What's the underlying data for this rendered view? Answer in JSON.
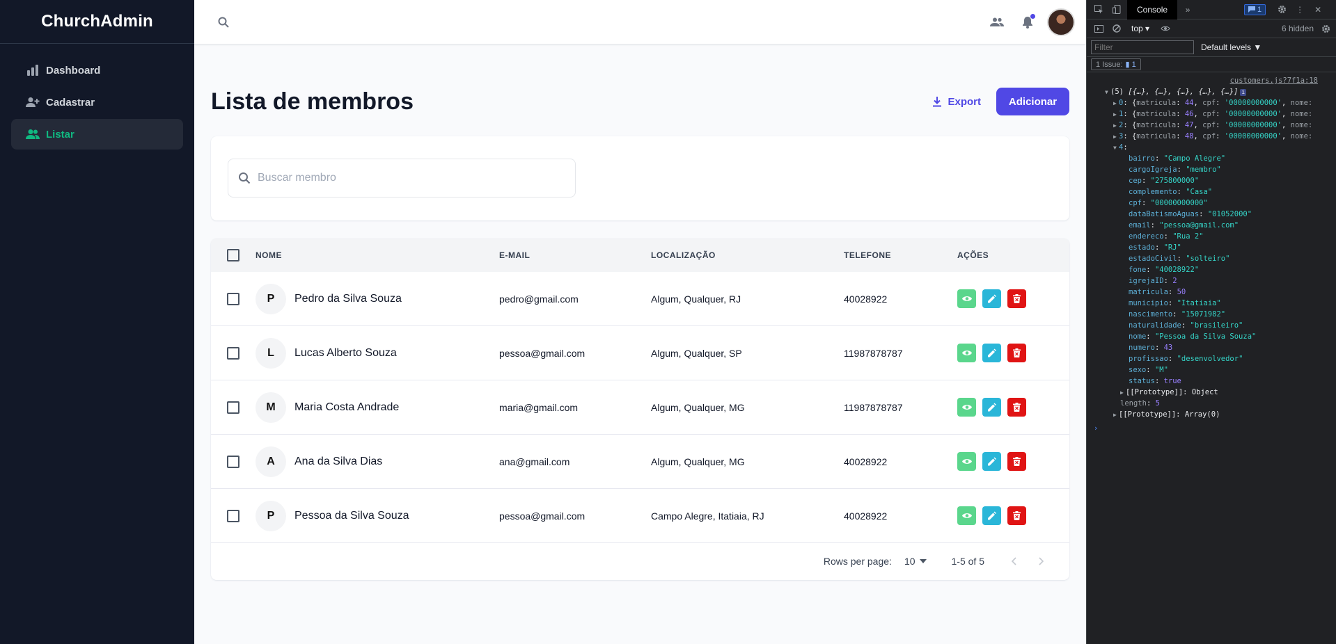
{
  "sidebar": {
    "brand": "ChurchAdmin",
    "items": [
      {
        "label": "Dashboard",
        "active": false,
        "icon": "chart-bar-icon"
      },
      {
        "label": "Cadastrar",
        "active": false,
        "icon": "user-add-icon"
      },
      {
        "label": "Listar",
        "active": true,
        "icon": "users-icon"
      }
    ]
  },
  "topbar": {
    "icons": [
      "search-icon",
      "contacts-icon",
      "bell-icon",
      "user-avatar"
    ]
  },
  "page": {
    "title": "Lista de membros",
    "export_label": "Export",
    "add_label": "Adicionar"
  },
  "search": {
    "placeholder": "Buscar membro"
  },
  "table": {
    "columns": [
      "NOME",
      "E-MAIL",
      "LOCALIZAÇÃO",
      "TELEFONE",
      "AÇÕES"
    ],
    "rows": [
      {
        "initial": "P",
        "name": "Pedro da Silva Souza",
        "email": "pedro@gmail.com",
        "location": "Algum, Qualquer, RJ",
        "phone": "40028922"
      },
      {
        "initial": "L",
        "name": "Lucas Alberto Souza",
        "email": "pessoa@gmail.com",
        "location": "Algum, Qualquer, SP",
        "phone": "11987878787"
      },
      {
        "initial": "M",
        "name": "Maria Costa Andrade",
        "email": "maria@gmail.com",
        "location": "Algum, Qualquer, MG",
        "phone": "11987878787"
      },
      {
        "initial": "A",
        "name": "Ana da Silva Dias",
        "email": "ana@gmail.com",
        "location": "Algum, Qualquer, MG",
        "phone": "40028922"
      },
      {
        "initial": "P",
        "name": "Pessoa da Silva Souza",
        "email": "pessoa@gmail.com",
        "location": "Campo Alegre, Itatiaia, RJ",
        "phone": "40028922"
      }
    ]
  },
  "pagination": {
    "rows_per_page_label": "Rows per page:",
    "rows_per_page_value": "10",
    "range": "1-5 of 5"
  },
  "colors": {
    "primary": "#5048e5",
    "sidebar_bg": "#121828",
    "active_green": "#10b981",
    "view_btn": "#5ad68c",
    "edit_btn": "#2ab6d8",
    "delete_btn": "#e01414"
  },
  "devtools": {
    "tab": "Console",
    "issue_badge": "1",
    "context": "top",
    "hidden": "6 hidden",
    "filter_placeholder": "Filter",
    "levels": "Default levels ▼",
    "issues_label": "1 Issue:",
    "issues_count": "1",
    "source_link": "customers.js?7f1a:18",
    "summary_count": "(5)",
    "summary_items": "[{…}, {…}, {…}, {…}, {…}]",
    "collapsed": [
      {
        "index": "0",
        "matricula": "44",
        "cpf": "'00000000000'"
      },
      {
        "index": "1",
        "matricula": "46",
        "cpf": "'00000000000'"
      },
      {
        "index": "2",
        "matricula": "47",
        "cpf": "'00000000000'"
      },
      {
        "index": "3",
        "matricula": "48",
        "cpf": "'00000000000'"
      }
    ],
    "expanded_index": "4",
    "properties": [
      {
        "key": "bairro",
        "value": "\"Campo Alegre\"",
        "type": "s"
      },
      {
        "key": "cargoIgreja",
        "value": "\"membro\"",
        "type": "s"
      },
      {
        "key": "cep",
        "value": "\"275800000\"",
        "type": "s"
      },
      {
        "key": "complemento",
        "value": "\"Casa\"",
        "type": "s"
      },
      {
        "key": "cpf",
        "value": "\"00000000000\"",
        "type": "s"
      },
      {
        "key": "dataBatismoAguas",
        "value": "\"01052000\"",
        "type": "s"
      },
      {
        "key": "email",
        "value": "\"pessoa@gmail.com\"",
        "type": "s"
      },
      {
        "key": "endereco",
        "value": "\"Rua 2\"",
        "type": "s"
      },
      {
        "key": "estado",
        "value": "\"RJ\"",
        "type": "s"
      },
      {
        "key": "estadoCivil",
        "value": "\"solteiro\"",
        "type": "s"
      },
      {
        "key": "fone",
        "value": "\"40028922\"",
        "type": "s"
      },
      {
        "key": "igrejaID",
        "value": "2",
        "type": "n"
      },
      {
        "key": "matricula",
        "value": "50",
        "type": "n"
      },
      {
        "key": "municipio",
        "value": "\"Itatiaia\"",
        "type": "s"
      },
      {
        "key": "nascimento",
        "value": "\"15071982\"",
        "type": "s"
      },
      {
        "key": "naturalidade",
        "value": "\"brasileiro\"",
        "type": "s"
      },
      {
        "key": "nome",
        "value": "\"Pessoa da Silva Souza\"",
        "type": "s"
      },
      {
        "key": "numero",
        "value": "43",
        "type": "n"
      },
      {
        "key": "profissao",
        "value": "\"desenvolvedor\"",
        "type": "s"
      },
      {
        "key": "sexo",
        "value": "\"M\"",
        "type": "s"
      },
      {
        "key": "status",
        "value": "true",
        "type": "b"
      }
    ],
    "object_proto": "[[Prototype]]: Object",
    "length_key": "length",
    "length_value": "5",
    "array_proto": "[[Prototype]]: Array(0)"
  }
}
